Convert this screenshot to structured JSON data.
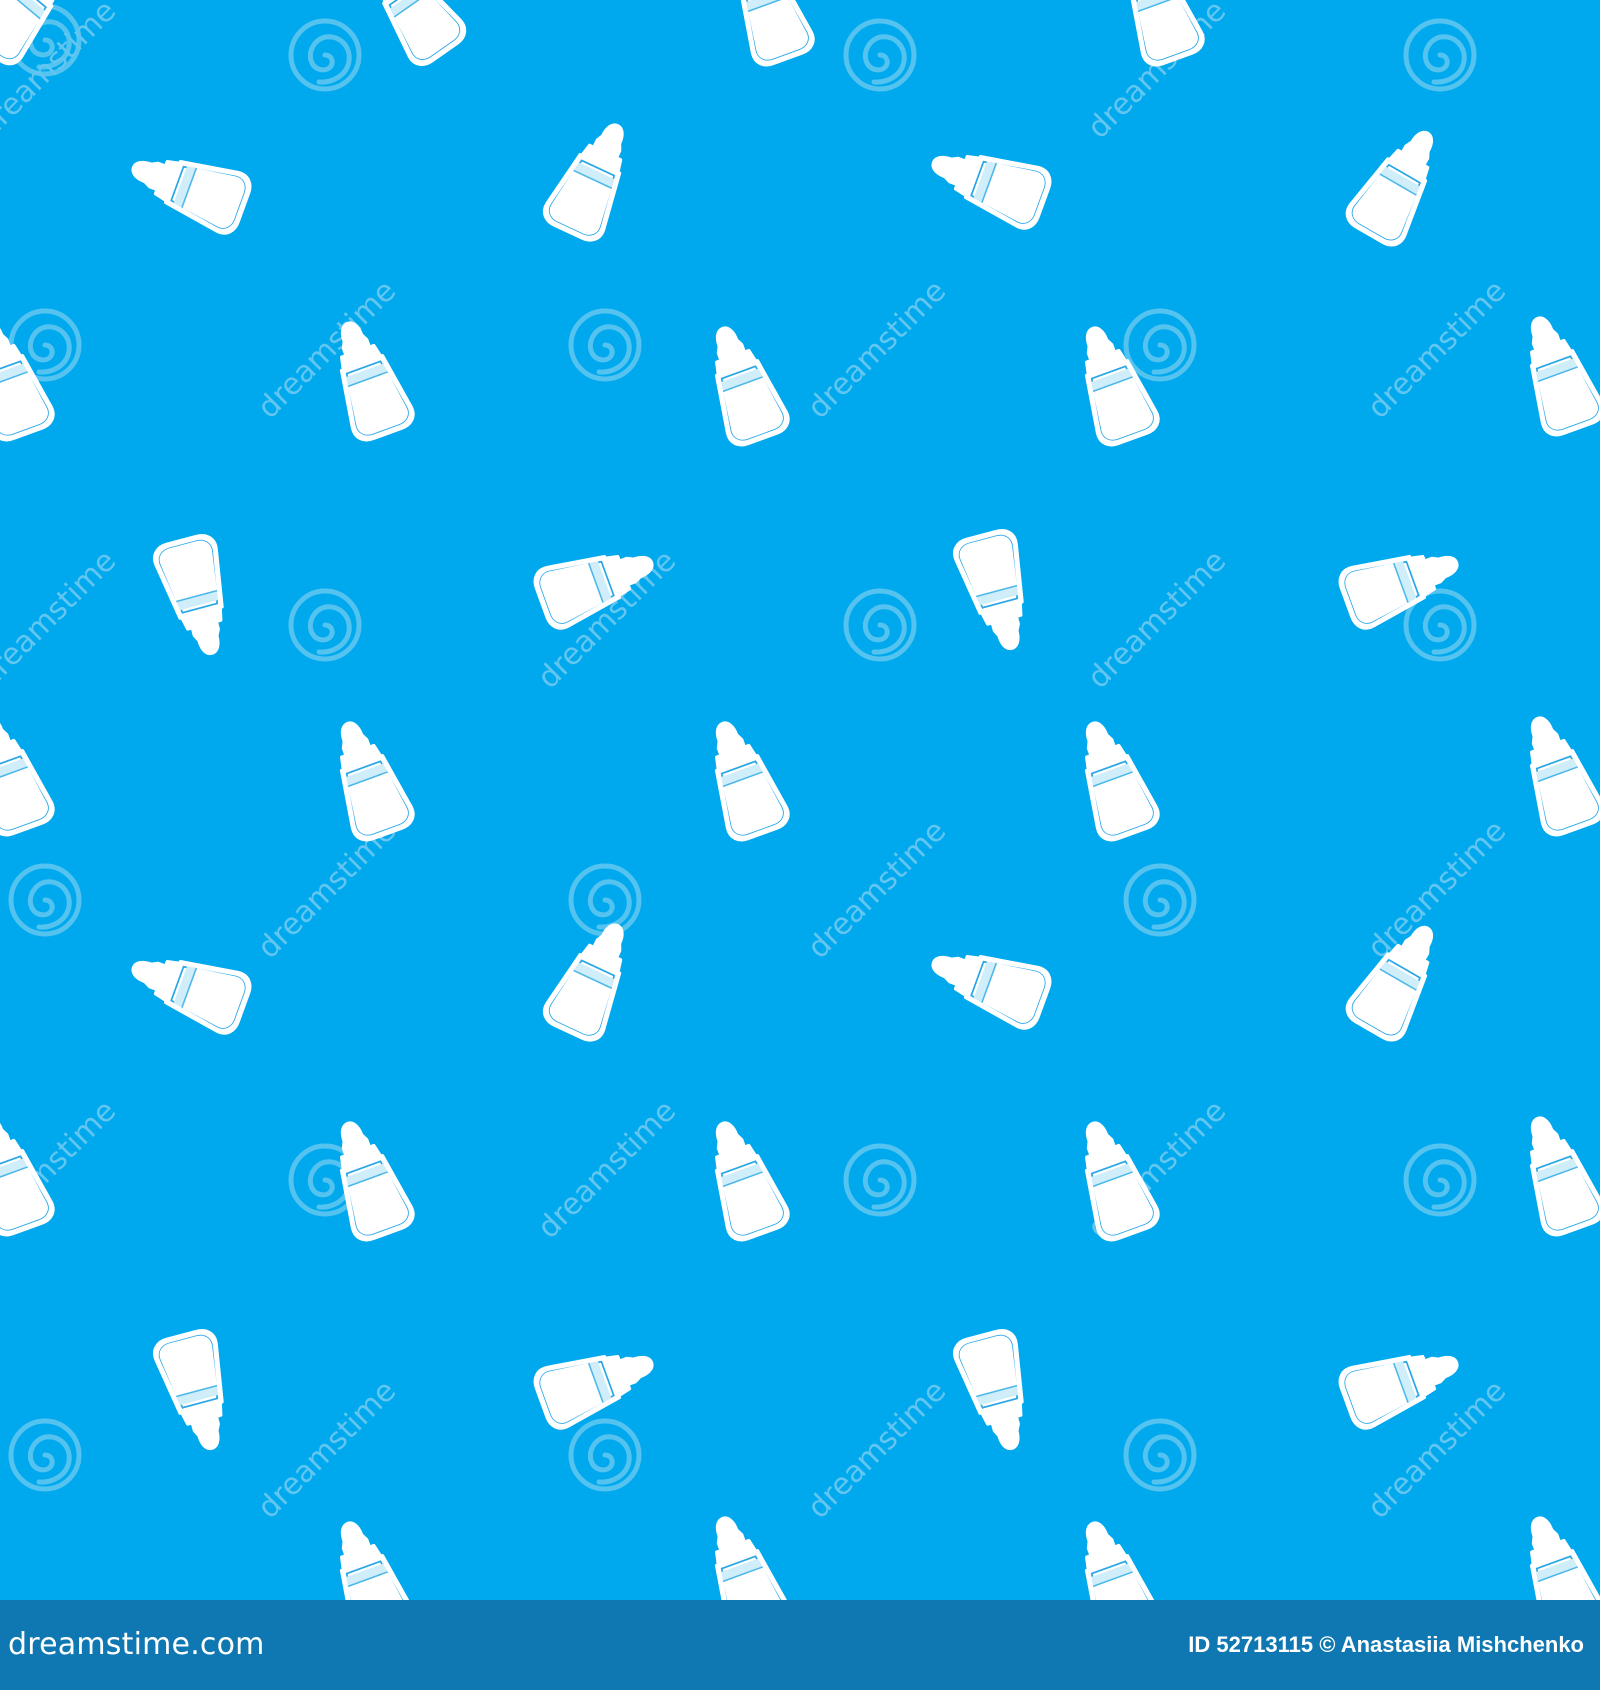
{
  "image": {
    "background_color": "#00a9ee",
    "footer_color": "#0f78b3",
    "motif": "baby-bottle-icon",
    "watermark_text": "dreamstime",
    "watermark_motif": "spiral-icon"
  },
  "footer": {
    "brand": "dreamstime.com",
    "credit": "ID 52713115 © Anastasiia Mishchenko"
  }
}
